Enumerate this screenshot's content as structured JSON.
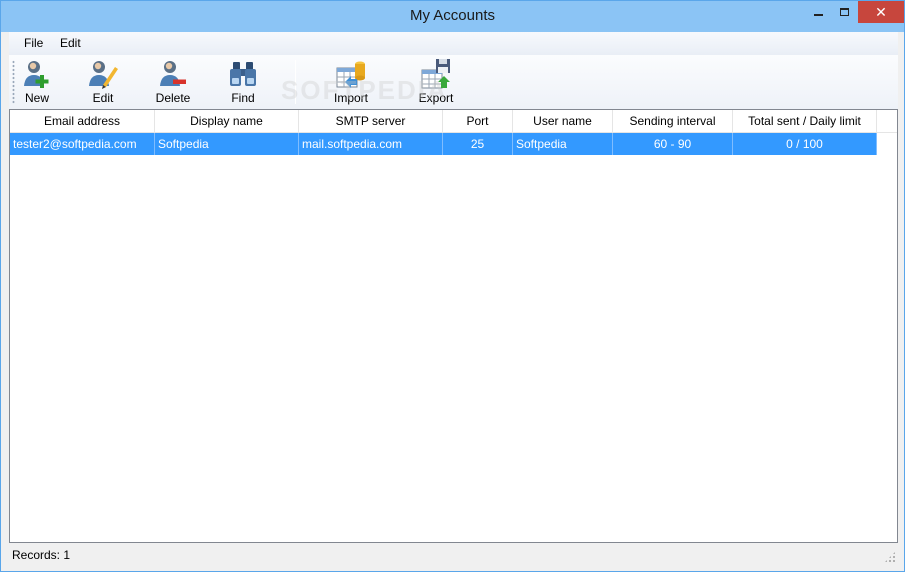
{
  "window": {
    "title": "My Accounts"
  },
  "menu": {
    "file": "File",
    "edit": "Edit"
  },
  "toolbar": {
    "new": "New",
    "edit": "Edit",
    "delete": "Delete",
    "find": "Find",
    "import": "Import",
    "export": "Export"
  },
  "table": {
    "columns": [
      "Email address",
      "Display name",
      "SMTP server",
      "Port",
      "User name",
      "Sending interval",
      "Total sent / Daily limit"
    ],
    "rows": [
      {
        "email": "tester2@softpedia.com",
        "display_name": "Softpedia",
        "smtp_server": "mail.softpedia.com",
        "port": "25",
        "user_name": "Softpedia",
        "sending_interval": "60 - 90",
        "total_sent": "0 / 100",
        "selected": true
      }
    ]
  },
  "status": {
    "records": "Records: 1"
  },
  "watermark": "SOFTPEDIA",
  "colors": {
    "titlebar": "#8bc4f5",
    "close_button": "#c7463d",
    "selection": "#3399ff"
  }
}
